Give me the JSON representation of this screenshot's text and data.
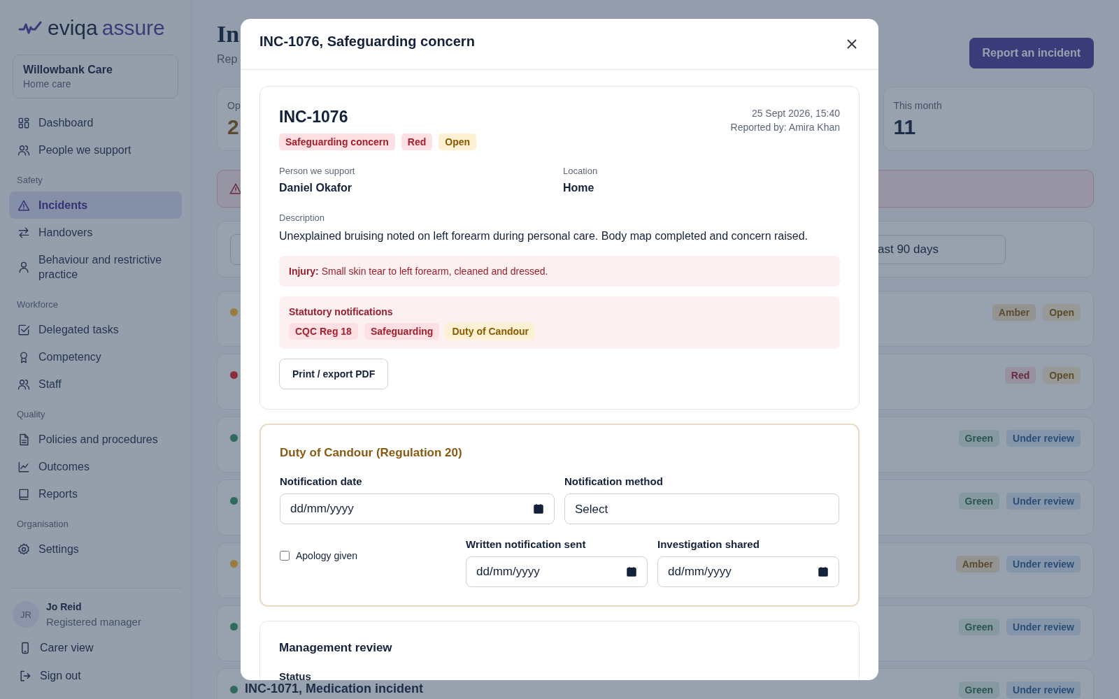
{
  "sidebar": {
    "logo": {
      "brand": "eviqa",
      "product": "assure"
    },
    "org": {
      "name": "Willowbank Care",
      "type": "Home care"
    },
    "nav": [
      {
        "items": [
          {
            "label": "Dashboard",
            "selected": false
          },
          {
            "label": "People we support",
            "selected": false
          }
        ]
      },
      {
        "heading": "Safety",
        "items": [
          {
            "label": "Incidents",
            "selected": true
          },
          {
            "label": "Handovers",
            "selected": false
          },
          {
            "label": "Behaviour and restrictive practice",
            "selected": false
          }
        ]
      },
      {
        "heading": "Workforce",
        "items": [
          {
            "label": "Delegated tasks",
            "selected": false
          },
          {
            "label": "Competency",
            "selected": false
          },
          {
            "label": "Staff",
            "selected": false
          }
        ]
      },
      {
        "heading": "Quality",
        "items": [
          {
            "label": "Policies and procedures",
            "selected": false
          },
          {
            "label": "Outcomes",
            "selected": false
          },
          {
            "label": "Reports",
            "selected": false
          }
        ]
      },
      {
        "heading": "Organisation",
        "items": [
          {
            "label": "Settings",
            "selected": false
          }
        ]
      }
    ],
    "user": {
      "initials": "JR",
      "name": "Jo Reid",
      "role": "Registered manager"
    },
    "footer_links": [
      "Carer view",
      "Sign out"
    ]
  },
  "main": {
    "title": "In",
    "subtitle": "Rep",
    "report_button": "Report an incident",
    "stats": [
      {
        "label": "Op",
        "value": "2",
        "kind": "amber"
      },
      {
        "label": "This month",
        "value": "11",
        "kind": "plain"
      }
    ],
    "filter_value": "ast 90 days",
    "rows": [
      {
        "color": "#9a7a3e",
        "tags": [
          {
            "label": "Amber",
            "kind": "amber"
          },
          {
            "label": "Open",
            "kind": "open"
          }
        ]
      },
      {
        "color": "#8b2d3c",
        "tags": [
          {
            "label": "Red",
            "kind": "red"
          },
          {
            "label": "Open",
            "kind": "open"
          }
        ]
      },
      {
        "color": "#2e6b5a",
        "tags": [
          {
            "label": "Green",
            "kind": "green"
          },
          {
            "label": "Under review",
            "kind": "review"
          }
        ]
      },
      {
        "color": "#2e6b5a",
        "tags": [
          {
            "label": "Green",
            "kind": "green"
          },
          {
            "label": "Under review",
            "kind": "review"
          }
        ]
      },
      {
        "color": "#9a7a3e",
        "tags": [
          {
            "label": "Amber",
            "kind": "amber"
          },
          {
            "label": "Under review",
            "kind": "review"
          }
        ]
      },
      {
        "color": "#2e6b5a",
        "tags": [
          {
            "label": "Green",
            "kind": "green"
          },
          {
            "label": "Under review",
            "kind": "review"
          }
        ]
      },
      {
        "color": "#2e6b5a",
        "title": "INC-1071, Medication incident",
        "tags": [
          {
            "label": "Green",
            "kind": "green"
          },
          {
            "label": "Under review",
            "kind": "review"
          }
        ]
      }
    ]
  },
  "modal": {
    "title": "INC-1076, Safeguarding concern",
    "incident": {
      "id": "INC-1076",
      "datetime": "25 Sept 2026, 15:40",
      "reporter": "Reported by: Amira Khan",
      "tags": [
        {
          "label": "Safeguarding concern",
          "kind": "red"
        },
        {
          "label": "Red",
          "kind": "red"
        },
        {
          "label": "Open",
          "kind": "open"
        }
      ],
      "fields": [
        {
          "label": "Person we support",
          "value": "Daniel Okafor"
        },
        {
          "label": "Location",
          "value": "Home"
        }
      ],
      "description": {
        "label": "Description",
        "text": "Unexplained bruising noted on left forearm during personal care. Body map completed and concern raised."
      },
      "injury": "**Injury:** Small skin tear to left forearm, cleaned and dressed.",
      "statutory": {
        "heading": "Statutory notifications",
        "tags": [
          {
            "label": "CQC Reg 18",
            "kind": "red"
          },
          {
            "label": "Safeguarding",
            "kind": "red"
          },
          {
            "label": "Duty of Candour",
            "kind": "open"
          }
        ]
      },
      "print_button": "Print / export PDF"
    },
    "duty": {
      "heading": "Duty of Candour (Regulation 20)",
      "notification_date": {
        "label": "Notification date",
        "placeholder": "dd/mm/yyyy"
      },
      "notification_method": {
        "label": "Notification method",
        "value": "Select"
      },
      "apology": {
        "label": "Apology given",
        "checked": false
      },
      "written_sent": {
        "label": "Written notification sent",
        "placeholder": "dd/mm/yyyy"
      },
      "investigation_shared": {
        "label": "Investigation shared",
        "placeholder": "dd/mm/yyyy"
      }
    },
    "management": {
      "heading": "Management review",
      "status_label": "Status"
    }
  }
}
